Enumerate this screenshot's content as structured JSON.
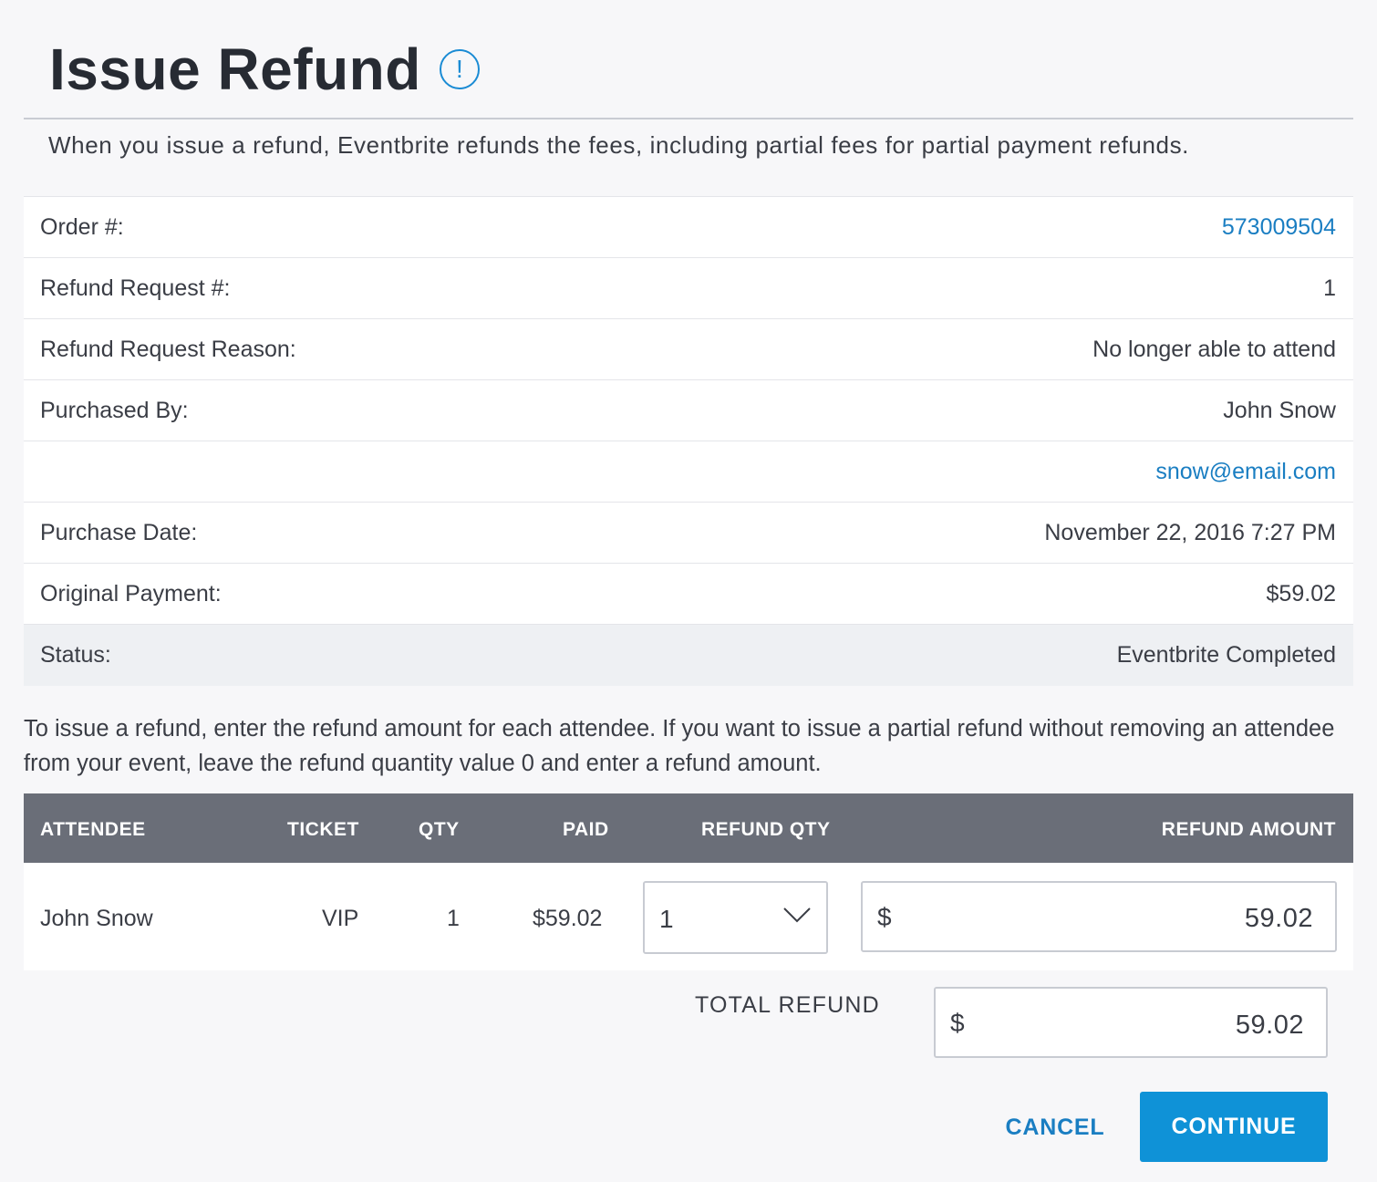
{
  "header": {
    "title": "Issue Refund",
    "info_icon_glyph": "!",
    "intro": "When you issue a refund, Eventbrite refunds the fees, including partial fees for partial payment refunds."
  },
  "details": {
    "order_label": "Order #:",
    "order_value": "573009504",
    "refund_request_label": "Refund Request #:",
    "refund_request_value": "1",
    "reason_label": "Refund Request Reason:",
    "reason_value": "No longer able to attend",
    "purchased_by_label": "Purchased By:",
    "purchased_by_value": "John Snow",
    "email_value": "snow@email.com",
    "purchase_date_label": "Purchase Date:",
    "purchase_date_value": "November 22, 2016 7:27 PM",
    "original_payment_label": "Original Payment:",
    "original_payment_value": "$59.02",
    "status_label": "Status:",
    "status_value": "Eventbrite Completed"
  },
  "instructions": "To issue a refund, enter the refund amount for each attendee. If you want to issue a partial refund without removing an attendee from your event, leave the refund quantity value 0 and enter a refund amount.",
  "table": {
    "headers": {
      "attendee": "ATTENDEE",
      "ticket": "TICKET",
      "qty": "QTY",
      "paid": "PAID",
      "refund_qty": "REFUND QTY",
      "refund_amount": "REFUND AMOUNT"
    },
    "rows": [
      {
        "attendee": "John Snow",
        "ticket": "VIP",
        "qty": "1",
        "paid": "$59.02",
        "refund_qty": "1",
        "currency": "$",
        "refund_amount": "59.02"
      }
    ]
  },
  "total": {
    "label": "TOTAL REFUND",
    "currency": "$",
    "value": "59.02"
  },
  "actions": {
    "cancel_label": "CANCEL",
    "continue_label": "CONTINUE"
  },
  "colors": {
    "accent": "#0f92d7",
    "link": "#1a7ec2",
    "table_header_bg": "#6a6e78",
    "status_row_bg": "#eef0f3",
    "page_bg": "#f7f7f9"
  },
  "icons": {
    "info": "info-icon",
    "dropdown": "chevron-down-icon"
  }
}
